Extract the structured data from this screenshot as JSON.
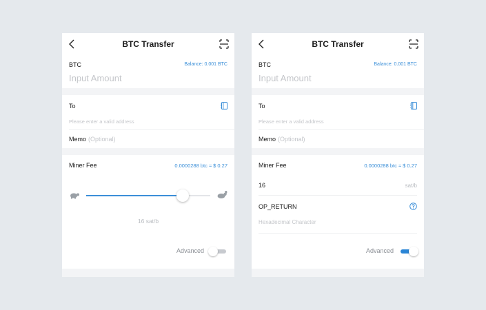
{
  "screens": [
    {
      "title": "BTC Transfer",
      "coin": "BTC",
      "balance": "Balance: 0.001 BTC",
      "amount_placeholder": "Input Amount",
      "to_label": "To",
      "address_placeholder": "Please enter a valid address",
      "memo_label": "Memo",
      "memo_optional": "(Optional)",
      "miner_fee_label": "Miner Fee",
      "miner_fee_value": "0.0000288 btc ≈ $ 0.27",
      "slider_level": 0.78,
      "sat_rate": "16 sat/b",
      "advanced_label": "Advanced",
      "advanced_enabled": false
    },
    {
      "title": "BTC Transfer",
      "coin": "BTC",
      "balance": "Balance: 0.001 BTC",
      "amount_placeholder": "Input Amount",
      "to_label": "To",
      "address_placeholder": "Please enter a valid address",
      "memo_label": "Memo",
      "memo_optional": "(Optional)",
      "miner_fee_label": "Miner Fee",
      "miner_fee_value": "0.0000288 btc ≈ $ 0.27",
      "sat_value": "16",
      "sat_unit": "sat/b",
      "op_return_label": "OP_RETURN",
      "hex_placeholder": "Hexadecimal Character",
      "advanced_label": "Advanced",
      "advanced_enabled": true
    }
  ],
  "colors": {
    "accent": "#3b8fd8",
    "toggle_on": "#2a85d6",
    "placeholder": "#c4c6ca",
    "background": "#e5e9ed"
  },
  "icons": [
    "back-arrow-icon",
    "scan-icon",
    "address-book-icon",
    "turtle-icon",
    "rabbit-icon",
    "help-icon"
  ]
}
